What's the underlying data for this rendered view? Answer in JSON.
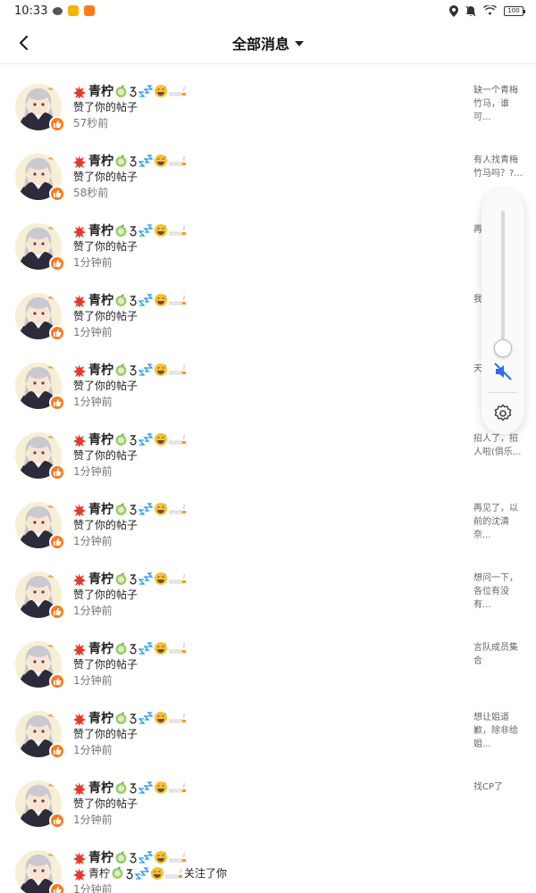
{
  "status_bar": {
    "time": "10:33",
    "battery": "100"
  },
  "header": {
    "title": "全部消息"
  },
  "colors": {
    "accent": "#ff7a1a",
    "mute": "#2a6cf0"
  },
  "messages": [
    {
      "user": "青柠",
      "action": "赞了你的帖子",
      "time": "57秒前",
      "post": "缺一个青梅竹马，谁可..."
    },
    {
      "user": "青柠",
      "action": "赞了你的帖子",
      "time": "58秒前",
      "post": "有人找青梅竹马吗？?..."
    },
    {
      "user": "青柠",
      "action": "赞了你的帖子",
      "time": "1分钟前",
      "post": "再曾的"
    },
    {
      "user": "青柠",
      "action": "赞了你的帖子",
      "time": "1分钟前",
      "post": "我了叫"
    },
    {
      "user": "青柠",
      "action": "赞了你的帖子",
      "time": "1分钟前",
      "post": "天晌闪"
    },
    {
      "user": "青柠",
      "action": "赞了你的帖子",
      "time": "1分钟前",
      "post": "招人了，招人啦(俱乐..."
    },
    {
      "user": "青柠",
      "action": "赞了你的帖子",
      "time": "1分钟前",
      "post": "再见了，以前的沈清奈..."
    },
    {
      "user": "青柠",
      "action": "赞了你的帖子",
      "time": "1分钟前",
      "post": "想问一下，各位有没有..."
    },
    {
      "user": "青柠",
      "action": "赞了你的帖子",
      "time": "1分钟前",
      "post": "言队成员集合"
    },
    {
      "user": "青柠",
      "action": "赞了你的帖子",
      "time": "1分钟前",
      "post": "想让姐道歉，除非给姐..."
    },
    {
      "user": "青柠",
      "action": "赞了你的帖子",
      "time": "1分钟前",
      "post": "找CP了"
    },
    {
      "user": "青柠",
      "action": "关注了你",
      "time": "1分钟前",
      "post": ""
    }
  ]
}
